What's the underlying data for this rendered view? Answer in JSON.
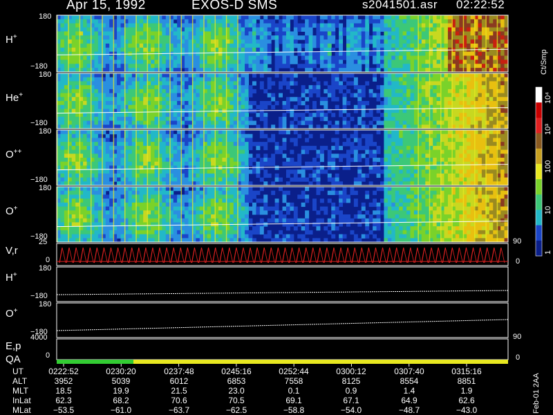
{
  "header": {
    "date": "Apr 15, 1992",
    "instrument": "EXOS-D SMS",
    "file": "s2041501.asr",
    "time": "02:22:52"
  },
  "colorbar": {
    "unit": "Ct/Smp",
    "ticks": [
      "10⁴",
      "10³",
      "100",
      "10",
      "1"
    ]
  },
  "chart_data": {
    "type": "heatmap",
    "title": "EXOS-D SMS",
    "panels": [
      {
        "label": "H+",
        "base": "H",
        "sup": "+",
        "ytop": "180",
        "ybottom": "−180",
        "ylim": [
          -180,
          180
        ]
      },
      {
        "label": "He+",
        "base": "He",
        "sup": "+",
        "ytop": "180",
        "ybottom": "−180",
        "ylim": [
          -180,
          180
        ]
      },
      {
        "label": "O++",
        "base": "O",
        "sup": "++",
        "ytop": "180",
        "ybottom": "−180",
        "ylim": [
          -180,
          180
        ]
      },
      {
        "label": "O+",
        "base": "O",
        "sup": "+",
        "ytop": "180",
        "ybottom": "−180",
        "ylim": [
          -180,
          180
        ]
      }
    ],
    "vr_panel": {
      "label": "V,r",
      "ytop": "25",
      "ymid": "0",
      "right_top": "90",
      "right_bottom": "0"
    },
    "line_panels": [
      {
        "base": "H",
        "sup": "+",
        "ytop": "180",
        "ybottom": "−180"
      },
      {
        "base": "O",
        "sup": "+",
        "ytop": "180",
        "ybottom": "−180"
      }
    ],
    "ep_panel": {
      "label": "E,p",
      "qa": "QA",
      "left_top": "4000",
      "left_bottom": "0",
      "right_top": "90",
      "right_bottom": "0"
    },
    "x_ticks": [
      "0222:52",
      "0230:20",
      "0237:48",
      "0245:16",
      "0252:44",
      "0300:12",
      "0307:40",
      "0315:16"
    ],
    "rows": [
      {
        "label": "UT",
        "values": [
          "0222:52",
          "0230:20",
          "0237:48",
          "0245:16",
          "0252:44",
          "0300:12",
          "0307:40",
          "0315:16"
        ]
      },
      {
        "label": "ALT",
        "values": [
          "3952",
          "5039",
          "6012",
          "6853",
          "7558",
          "8125",
          "8554",
          "8851"
        ]
      },
      {
        "label": "MLT",
        "values": [
          "18.5",
          "19.9",
          "21.5",
          "23.0",
          "0.1",
          "0.9",
          "1.4",
          "1.9"
        ]
      },
      {
        "label": "InLat",
        "values": [
          "62.3",
          "68.2",
          "70.6",
          "70.5",
          "69.1",
          "67.1",
          "64.9",
          "62.6"
        ]
      },
      {
        "label": "MLat",
        "values": [
          "−53.5",
          "−61.0",
          "−63.7",
          "−62.5",
          "−58.8",
          "−54.0",
          "−48.7",
          "−43.0"
        ]
      }
    ],
    "qa_segments": [
      {
        "from": 0,
        "to": 0.17,
        "color": "#33cc33"
      },
      {
        "from": 0.17,
        "to": 1,
        "color": "#e8e820"
      }
    ]
  },
  "footer": {
    "side_note": "Feb-01 2AA"
  }
}
